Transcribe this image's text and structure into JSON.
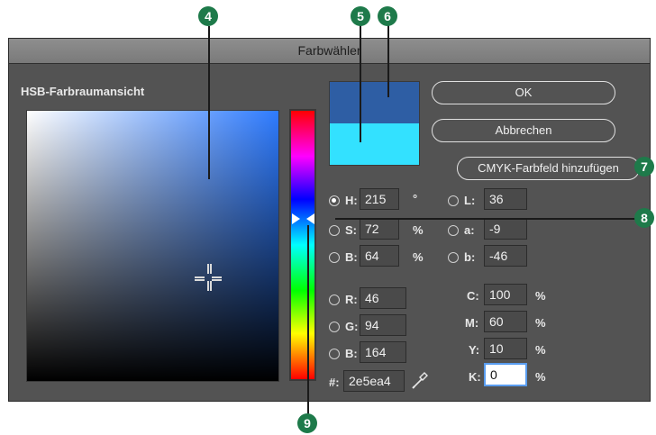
{
  "dialog": {
    "title": "Farbwähler",
    "hsb_view_title": "HSB-Farbraumansicht",
    "buttons": {
      "ok": "OK",
      "cancel": "Abbrechen",
      "add_swatch": "CMYK-Farbfeld hinzufügen"
    },
    "hsb": [
      {
        "label": "H:",
        "value": "215",
        "unit": "°",
        "selected": true
      },
      {
        "label": "S:",
        "value": "72",
        "unit": "%",
        "selected": false
      },
      {
        "label": "B:",
        "value": "64",
        "unit": "%",
        "selected": false
      }
    ],
    "rgb": [
      {
        "label": "R:",
        "value": "46"
      },
      {
        "label": "G:",
        "value": "94"
      },
      {
        "label": "B:",
        "value": "164"
      }
    ],
    "lab": [
      {
        "label": "L:",
        "value": "36"
      },
      {
        "label": "a:",
        "value": "-9"
      },
      {
        "label": "b:",
        "value": "-46"
      }
    ],
    "cmyk": [
      {
        "label": "C:",
        "value": "100",
        "unit": "%"
      },
      {
        "label": "M:",
        "value": "60",
        "unit": "%"
      },
      {
        "label": "Y:",
        "value": "10",
        "unit": "%"
      },
      {
        "label": "K:",
        "value": "0",
        "unit": "%"
      }
    ],
    "hex_label": "#:",
    "hex_value": "2e5ea4",
    "colors": {
      "new": "#2e5ea4",
      "current": "#33e1ff"
    }
  },
  "callouts": [
    "4",
    "5",
    "6",
    "7",
    "8",
    "9"
  ]
}
